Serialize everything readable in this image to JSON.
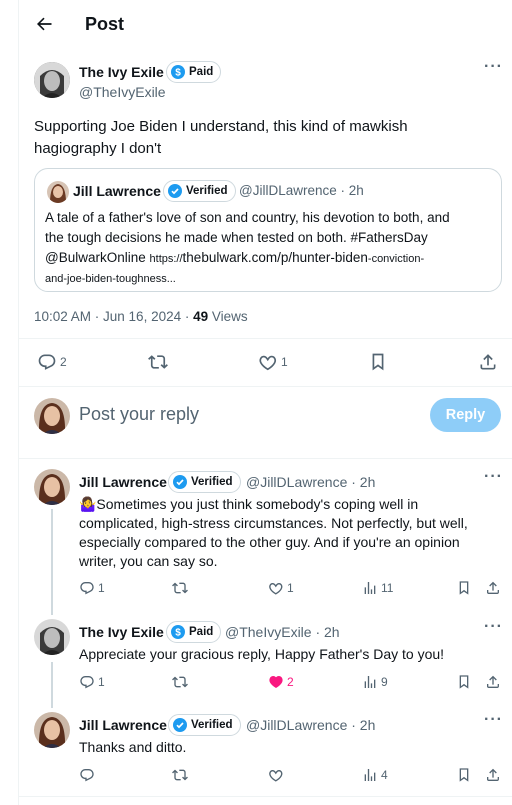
{
  "header": {
    "back_icon": "arrow-left-icon",
    "title": "Post"
  },
  "main_post": {
    "author_name": "The Ivy Exile",
    "badge": "Paid",
    "handle": "@TheIvyExile",
    "text_line1": "Supporting Joe Biden I understand, this kind of mawkish",
    "text_line2": "hagiography I don't",
    "quote": {
      "author_name": "Jill Lawrence",
      "badge": "Verified",
      "handle_time": "@JillDLawrence · 2h",
      "line1": "A tale of a father's love of son and country, his devotion to both, and",
      "line2": "the tough decisions he made when tested on both. #FathersDay",
      "line3_handle": "@BulwarkOnline",
      "line3_url_prefix": "https://",
      "line3_url": "thebulwark.com/p/hunter-biden",
      "line3_url_tail": "-conviction-",
      "line4_url": "and-joe-biden-toughness..."
    },
    "meta_time": "10:02 AM · Jun 16, 2024 · ",
    "meta_views_count": "49",
    "meta_views_label": " Views",
    "replies": "2",
    "likes": "1"
  },
  "reply_box": {
    "placeholder": "Post your reply",
    "button": "Reply"
  },
  "replies": [
    {
      "author_name": "Jill Lawrence",
      "badge": "Verified",
      "handle_time": "@JillDLawrence · 2h",
      "lines": [
        "🤷‍♀️Sometimes you just think somebody's coping well in",
        "complicated, high-stress circumstances. Not perfectly, but well,",
        "especially compared to the other guy. And if you're an opinion",
        "writer, you can say so."
      ],
      "replies": "1",
      "reposts": "",
      "likes": "1",
      "views": "11"
    },
    {
      "author_name": "The Ivy Exile",
      "badge": "Paid",
      "handle_time": "@TheIvyExile · 2h",
      "lines": [
        "Appreciate your gracious reply, Happy Father's Day to you!"
      ],
      "replies": "1",
      "reposts": "",
      "likes": "2",
      "views": "9"
    },
    {
      "author_name": "Jill Lawrence",
      "badge": "Verified",
      "handle_time": "@JillDLawrence · 2h",
      "lines": [
        "Thanks and ditto."
      ],
      "replies": "",
      "reposts": "",
      "likes": "",
      "views": "4"
    }
  ],
  "colors": {
    "accent": "#1d9bf0",
    "reply_button_disabled": "#8ecdf8",
    "like_active": "#f91880",
    "text": "#0f1419",
    "muted": "#536471"
  }
}
